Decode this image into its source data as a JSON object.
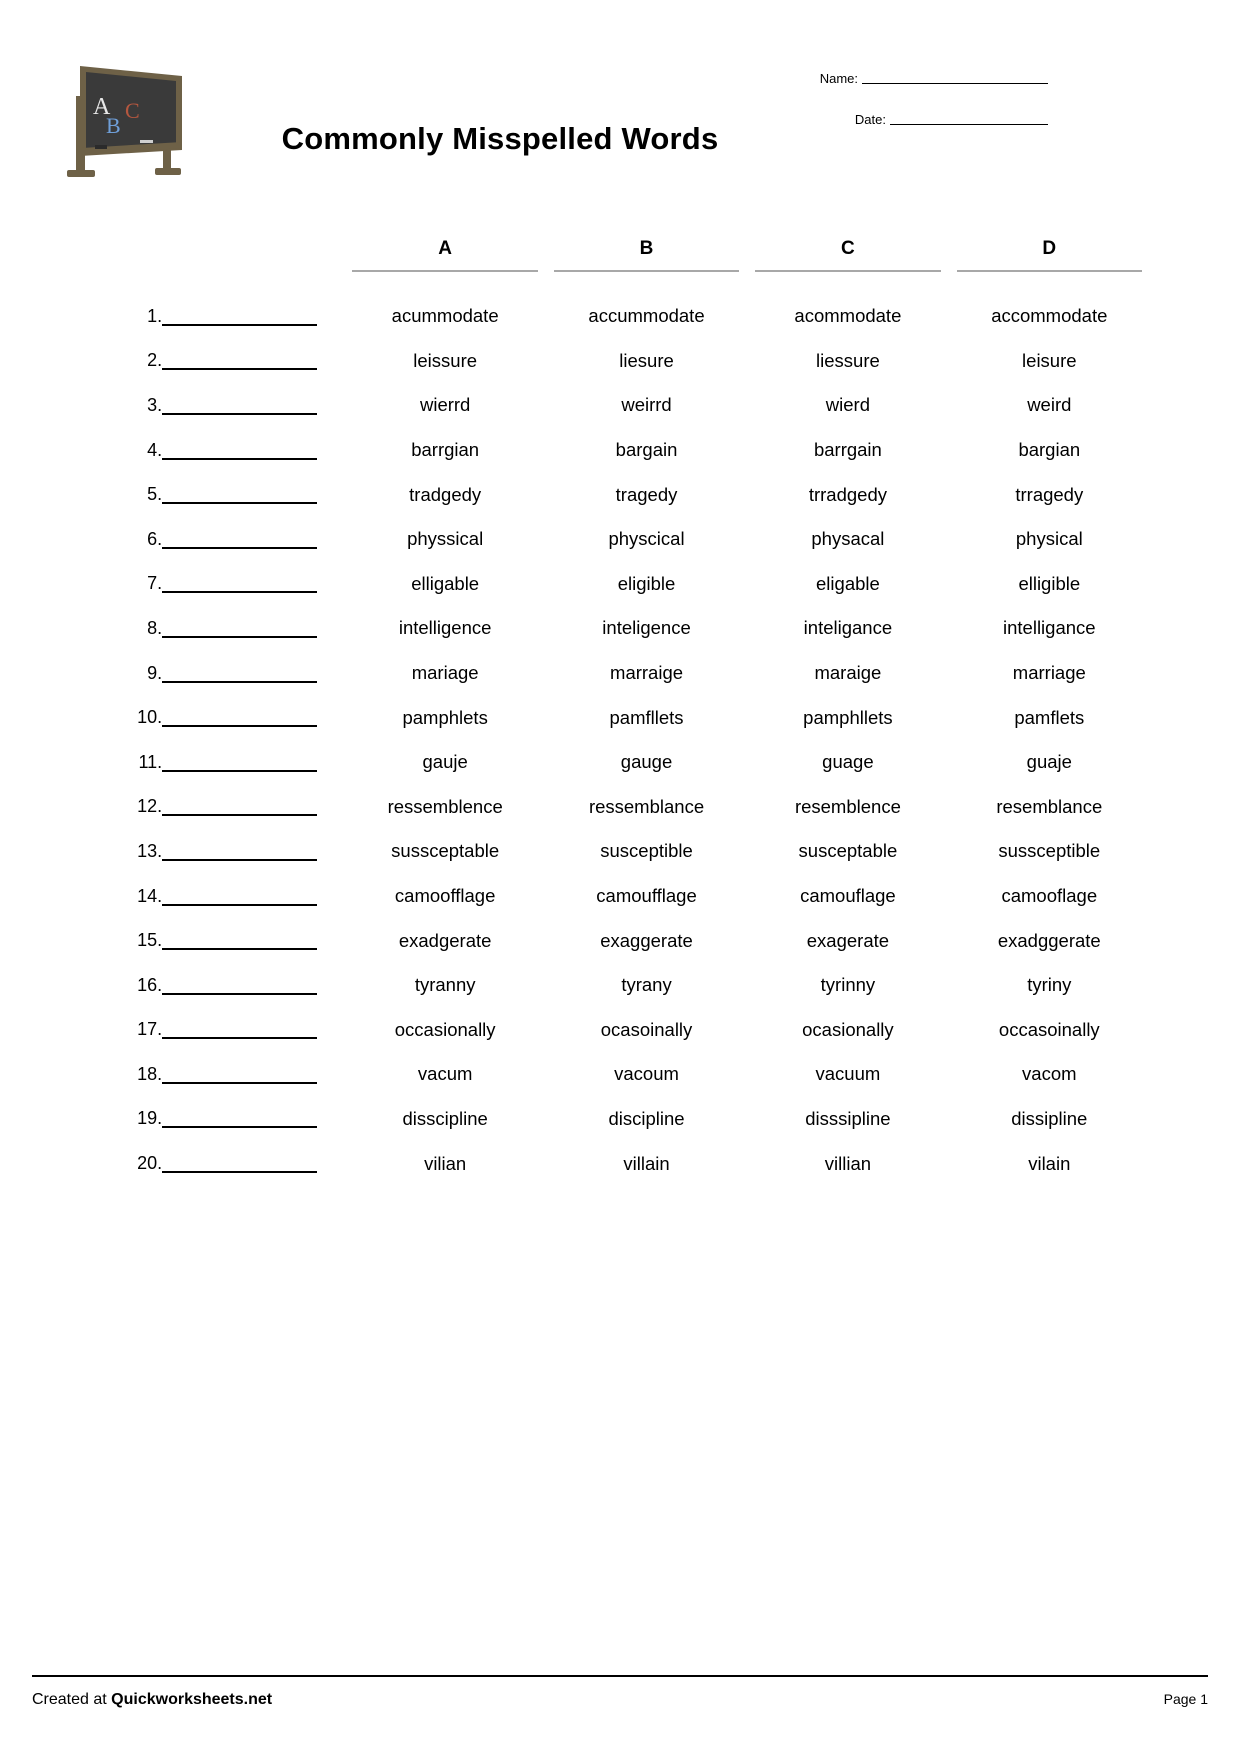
{
  "header": {
    "title": "Commonly Misspelled Words",
    "name_label": "Name:",
    "date_label": "Date:",
    "chalkboard_letters": [
      "A",
      "B",
      "C"
    ],
    "chalkboard_colors": {
      "board": "#3a3a3a",
      "frame": "#6e6147",
      "letter_a": "#e8e8e8",
      "letter_b": "#6f9fd8",
      "letter_c": "#b5573f"
    }
  },
  "table": {
    "column_headers": [
      "A",
      "B",
      "C",
      "D"
    ],
    "rows": [
      {
        "num": "1.",
        "options": [
          "acummodate",
          "accummodate",
          "acommodate",
          "accommodate"
        ]
      },
      {
        "num": "2.",
        "options": [
          "leissure",
          "liesure",
          "liessure",
          "leisure"
        ]
      },
      {
        "num": "3.",
        "options": [
          "wierrd",
          "weirrd",
          "wierd",
          "weird"
        ]
      },
      {
        "num": "4.",
        "options": [
          "barrgian",
          "bargain",
          "barrgain",
          "bargian"
        ]
      },
      {
        "num": "5.",
        "options": [
          "tradgedy",
          "tragedy",
          "trradgedy",
          "trragedy"
        ]
      },
      {
        "num": "6.",
        "options": [
          "physsical",
          "physcical",
          "physacal",
          "physical"
        ]
      },
      {
        "num": "7.",
        "options": [
          "elligable",
          "eligible",
          "eligable",
          "elligible"
        ]
      },
      {
        "num": "8.",
        "options": [
          "intelligence",
          "inteligence",
          "inteligance",
          "intelligance"
        ]
      },
      {
        "num": "9.",
        "options": [
          "mariage",
          "marraige",
          "maraige",
          "marriage"
        ]
      },
      {
        "num": "10.",
        "options": [
          "pamphlets",
          "pamfllets",
          "pamphllets",
          "pamflets"
        ]
      },
      {
        "num": "11.",
        "options": [
          "gauje",
          "gauge",
          "guage",
          "guaje"
        ]
      },
      {
        "num": "12.",
        "options": [
          "ressemblence",
          "ressemblance",
          "resemblence",
          "resemblance"
        ]
      },
      {
        "num": "13.",
        "options": [
          "sussceptable",
          "susceptible",
          "susceptable",
          "sussceptible"
        ]
      },
      {
        "num": "14.",
        "options": [
          "camoofflage",
          "camoufflage",
          "camouflage",
          "camooflage"
        ]
      },
      {
        "num": "15.",
        "options": [
          "exadgerate",
          "exaggerate",
          "exagerate",
          "exadggerate"
        ]
      },
      {
        "num": "16.",
        "options": [
          "tyranny",
          "tyrany",
          "tyrinny",
          "tyriny"
        ]
      },
      {
        "num": "17.",
        "options": [
          "occasionally",
          "ocasoinally",
          "ocasionally",
          "occasoinally"
        ]
      },
      {
        "num": "18.",
        "options": [
          "vacum",
          "vacoum",
          "vacuum",
          "vacom"
        ]
      },
      {
        "num": "19.",
        "options": [
          "disscipline",
          "discipline",
          "disssipline",
          "dissipline"
        ]
      },
      {
        "num": "20.",
        "options": [
          "vilian",
          "villain",
          "villian",
          "vilain"
        ]
      }
    ]
  },
  "footer": {
    "created_prefix": "Created at ",
    "created_brand": "Quickworksheets.net",
    "page_label": "Page 1"
  }
}
